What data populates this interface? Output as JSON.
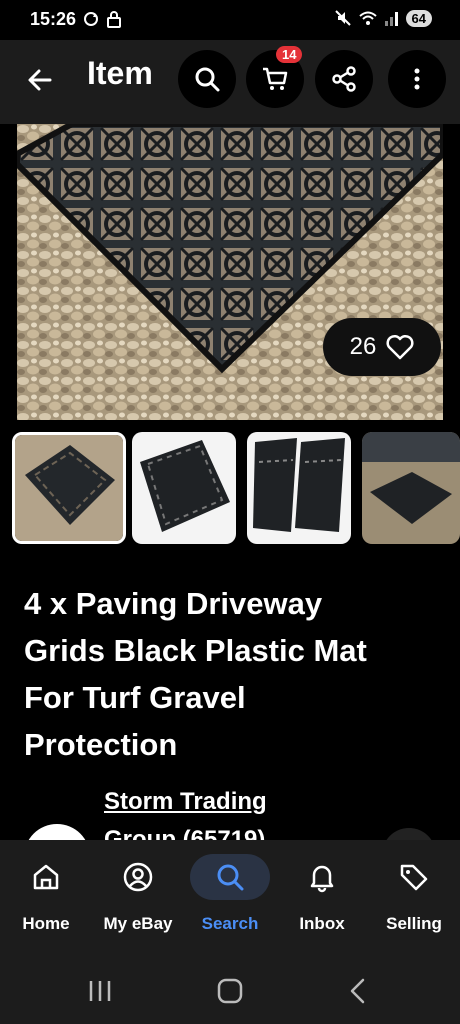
{
  "status_bar": {
    "time": "15:26",
    "battery": "64",
    "left_icons": [
      "sync-icon",
      "lock-icon"
    ],
    "right_icons": [
      "mute-icon",
      "wifi-icon",
      "signal-icon"
    ]
  },
  "app_bar": {
    "title": "Item",
    "cart_count": "14",
    "icons": [
      "back-arrow-icon",
      "search-icon",
      "cart-icon",
      "share-icon",
      "more-icon"
    ]
  },
  "listing": {
    "watch_count": "26",
    "title_lines": [
      "4 x Paving Driveway",
      "Grids Black Plastic Mat",
      "For Turf Gravel",
      "Protection"
    ],
    "seller_line1": "Storm Trading",
    "seller_line2": "Group (65719)"
  },
  "thumbnails": [
    "grid-on-gravel",
    "single-grid-white-bg",
    "stacked-grids",
    "grid-in-driveway"
  ],
  "bottom_nav": [
    {
      "label": "Home",
      "icon": "home-icon",
      "active": false
    },
    {
      "label": "My eBay",
      "icon": "profile-icon",
      "active": false
    },
    {
      "label": "Search",
      "icon": "search-icon",
      "active": true
    },
    {
      "label": "Inbox",
      "icon": "bell-icon",
      "active": false
    },
    {
      "label": "Selling",
      "icon": "tag-icon",
      "active": false
    }
  ],
  "colors": {
    "accent": "#4b8ef5",
    "badge": "#e53238",
    "bar_bg": "#1c1c1c"
  }
}
